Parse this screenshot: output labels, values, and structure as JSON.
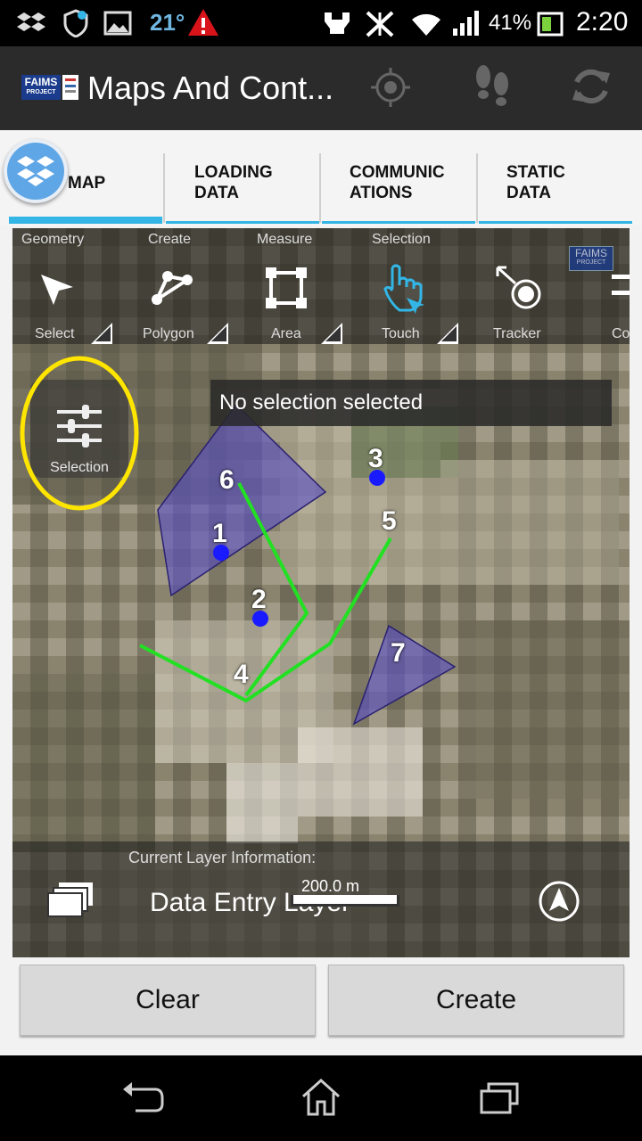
{
  "status_bar": {
    "temperature": "21°",
    "battery_percent": "41%",
    "time": "2:20",
    "icons": [
      "dropbox-icon",
      "shield-icon",
      "image-icon",
      "temperature-icon",
      "warning-icon",
      "usb-icon",
      "mute-icon",
      "wifi-icon",
      "signal-icon",
      "battery-icon"
    ]
  },
  "action_bar": {
    "logo_text": "FAIMS",
    "logo_sub": "PROJECT",
    "title": "Maps And Cont...",
    "actions": [
      "gps-icon",
      "footsteps-icon",
      "sync-icon"
    ]
  },
  "tabs": [
    {
      "label": "MAP",
      "selected": true
    },
    {
      "label": "LOADING DATA",
      "line1": "LOADING",
      "line2": "DATA"
    },
    {
      "label": "COMMUNICATIONS",
      "line1": "COMMUNIC",
      "line2": "ATIONS"
    },
    {
      "label": "STATIC DATA",
      "line1": "STATIC",
      "line2": "DATA"
    }
  ],
  "map_toolbar": {
    "categories": [
      "Geometry",
      "Create",
      "Measure",
      "Selection"
    ],
    "tools": [
      {
        "label": "Select",
        "icon": "arrow-cursor-icon"
      },
      {
        "label": "Polygon",
        "icon": "polygon-icon"
      },
      {
        "label": "Area",
        "icon": "area-icon"
      },
      {
        "label": "Touch",
        "icon": "touch-hand-icon",
        "active": true
      },
      {
        "label": "Tracker",
        "icon": "tracker-icon"
      },
      {
        "label": "Co",
        "icon": "config-icon"
      }
    ],
    "faims_badge": "FAIMS",
    "faims_badge_sub": "PROJECT"
  },
  "selection_panel": {
    "label": "Selection",
    "icon": "sliders-icon"
  },
  "map": {
    "status_message": "No selection selected",
    "features": [
      {
        "label": "1",
        "type": "point"
      },
      {
        "label": "2",
        "type": "point"
      },
      {
        "label": "3",
        "type": "point"
      },
      {
        "label": "4",
        "type": "line"
      },
      {
        "label": "5",
        "type": "line"
      },
      {
        "label": "6",
        "type": "polygon"
      },
      {
        "label": "7",
        "type": "polygon"
      }
    ],
    "colors": {
      "polygon": "#5a50c8",
      "point": "#1a1aff",
      "line": "#22e022",
      "highlight": "#ffe500"
    }
  },
  "layer_info": {
    "caption": "Current Layer Information:",
    "name": "Data Entry Layer",
    "scale": "200.0 m"
  },
  "buttons": {
    "clear": "Clear",
    "create": "Create"
  },
  "accent_color": "#33b5e5"
}
